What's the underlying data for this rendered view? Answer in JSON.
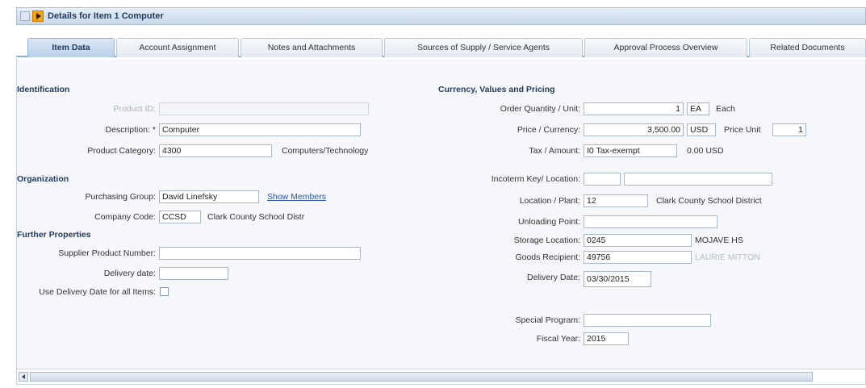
{
  "window": {
    "title": "Details for Item 1 Computer"
  },
  "tabs": [
    {
      "label": "Item Data"
    },
    {
      "label": "Account Assignment"
    },
    {
      "label": "Notes and Attachments"
    },
    {
      "label": "Sources of Supply / Service Agents"
    },
    {
      "label": "Approval Process Overview"
    },
    {
      "label": "Related Documents"
    }
  ],
  "identification": {
    "title": "Identification",
    "product_id": {
      "label": "Product ID:",
      "value": ""
    },
    "description": {
      "label": "Description: *",
      "value": "Computer"
    },
    "product_category": {
      "label": "Product Category:",
      "value": "4300",
      "text": "Computers/Technology"
    }
  },
  "organization": {
    "title": "Organization",
    "purchasing_group": {
      "label": "Purchasing Group:",
      "value": "David Linefsky",
      "link": "Show Members"
    },
    "company_code": {
      "label": "Company Code:",
      "value": "CCSD",
      "text": "Clark County School Distr"
    }
  },
  "further_properties": {
    "title": "Further Properties",
    "supplier_product_number": {
      "label": "Supplier Product Number:",
      "value": ""
    },
    "delivery_date": {
      "label": "Delivery date:",
      "value": ""
    },
    "use_delivery_date": {
      "label": "Use Delivery Date for all Items:",
      "checked": false
    }
  },
  "currency": {
    "title": "Currency, Values and Pricing",
    "order_quantity": {
      "label": "Order Quantity / Unit:",
      "value": "1",
      "unit": "EA",
      "unit_text": "Each"
    },
    "price": {
      "label": "Price / Currency:",
      "value": "3,500.00",
      "currency": "USD",
      "price_unit_label": "Price Unit",
      "price_unit": "1"
    },
    "tax": {
      "label": "Tax / Amount:",
      "value": "I0 Tax-exempt",
      "amount": "0.00 USD"
    },
    "incoterm": {
      "label": "Incoterm Key/ Location:",
      "key": "",
      "location": ""
    },
    "location_plant": {
      "label": "Location / Plant:",
      "value": "12",
      "text": "Clark County School District"
    },
    "unloading_point": {
      "label": "Unloading Point:",
      "value": ""
    },
    "storage_location": {
      "label": "Storage Location:",
      "value": "0245",
      "text": "MOJAVE HS"
    },
    "goods_recipient": {
      "label": "Goods Recipient:",
      "value": "49756",
      "text": "LAURIE MITTON"
    },
    "delivery_date": {
      "label": "Delivery Date:",
      "value": "03/30/2015"
    },
    "special_program": {
      "label": "Special Program:",
      "value": ""
    },
    "fiscal_year": {
      "label": "Fiscal Year:",
      "value": "2015"
    }
  },
  "colors": {
    "accent": "#f2a410",
    "tab_active": "#b8cfe9",
    "link": "#2a55a8",
    "section_title": "#1f3a5f"
  }
}
